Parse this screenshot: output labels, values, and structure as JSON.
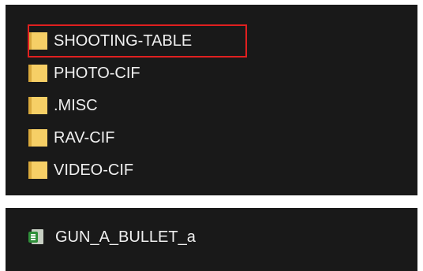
{
  "folders": [
    {
      "label": "SHOOTING-TABLE",
      "icon": "folder-icon",
      "selected": true
    },
    {
      "label": "PHOTO-CIF",
      "icon": "folder-icon",
      "selected": false
    },
    {
      "label": ".MISC",
      "icon": "folder-icon",
      "selected": false
    },
    {
      "label": "RAV-CIF",
      "icon": "folder-icon",
      "selected": false
    },
    {
      "label": "VIDEO-CIF",
      "icon": "folder-icon",
      "selected": false
    }
  ],
  "files": [
    {
      "label": "GUN_A_BULLET_a",
      "icon": "spreadsheet-file-icon"
    }
  ],
  "colors": {
    "background": "#191919",
    "text": "#f0f0f0",
    "folder": "#f6cf66",
    "highlight_border": "#e02020",
    "sheet_badge": "#2f8f3a"
  }
}
